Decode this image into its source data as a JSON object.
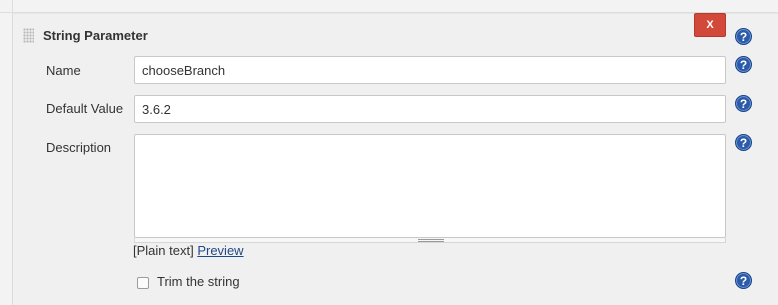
{
  "section": {
    "title": "String Parameter",
    "delete_label": "X",
    "help_glyph": "?"
  },
  "fields": {
    "name": {
      "label": "Name",
      "value": "chooseBranch"
    },
    "default_value": {
      "label": "Default Value",
      "value": "3.6.2"
    },
    "description": {
      "label": "Description",
      "value": ""
    }
  },
  "description_footer": {
    "plain_text": "[Plain text]",
    "preview_link": "Preview"
  },
  "trim": {
    "label": "Trim the string",
    "checked": false
  },
  "colors": {
    "delete_button": "#d24939",
    "help_icon": "#2a5aa8",
    "link": "#204a87",
    "panel_background": "#f0f0f0"
  },
  "icons": [
    "drag-handle-icon",
    "close-icon",
    "help-icon"
  ]
}
